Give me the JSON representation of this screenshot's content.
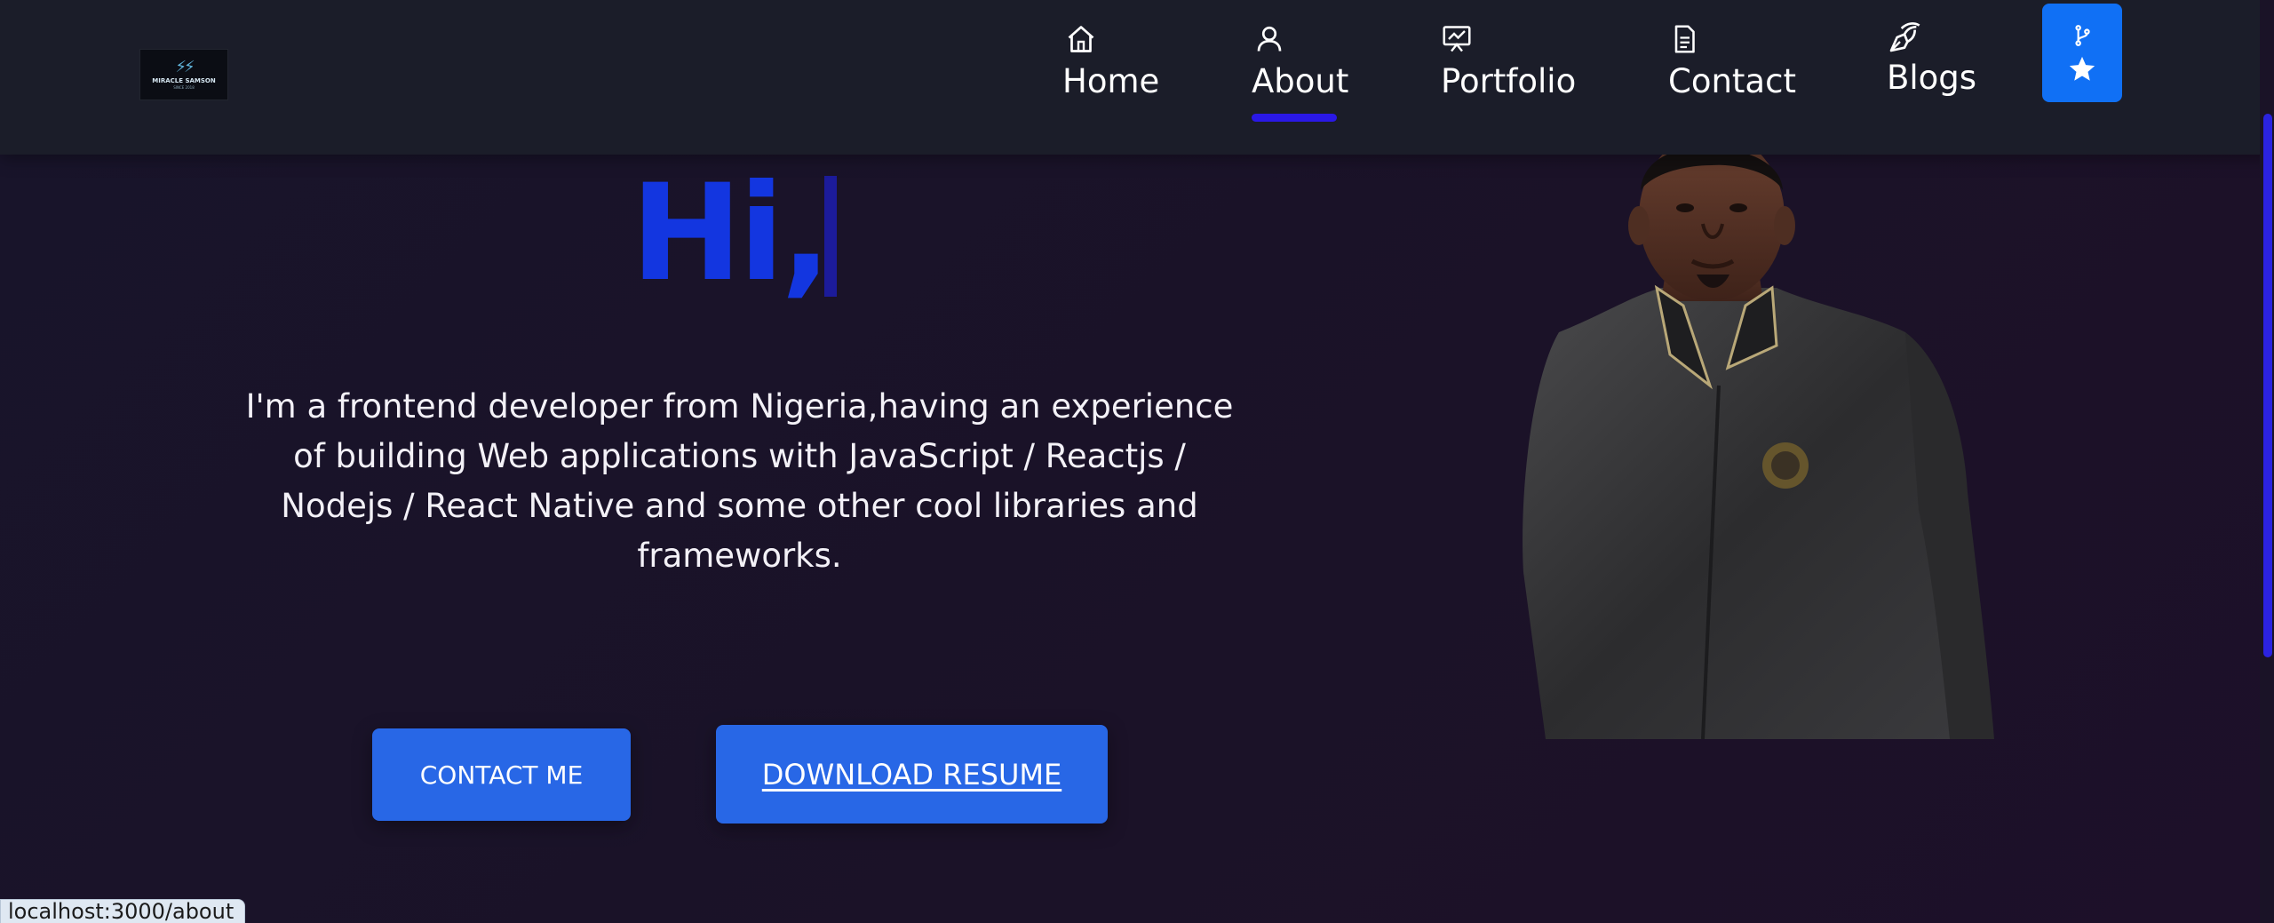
{
  "brand": {
    "logo_name": "MIRACLE SAMSON",
    "logo_tagline": "SINCE 2018"
  },
  "nav": {
    "items": [
      {
        "label": "Home",
        "icon": "home-icon",
        "active": false
      },
      {
        "label": "About",
        "icon": "user-icon",
        "active": true
      },
      {
        "label": "Portfolio",
        "icon": "presentation-chart-icon",
        "active": false
      },
      {
        "label": "Contact",
        "icon": "document-icon",
        "active": false
      },
      {
        "label": "Blogs",
        "icon": "pen-nib-icon",
        "active": false
      }
    ],
    "github_button_icons": [
      "git-fork-icon",
      "star-icon"
    ]
  },
  "hero": {
    "greeting": "Hi,",
    "intro": "I'm a frontend developer from Nigeria,having an experience of building Web applications with JavaScript / Reactjs / Nodejs / React Native and some other cool libraries and frameworks.",
    "contact_button": "CONTACT ME",
    "resume_button": "DOWNLOAD RESUME"
  },
  "status_bar": {
    "url": "localhost:3000/about"
  },
  "colors": {
    "background": "#1b1228",
    "navbar": "#1b1d29",
    "accent_blue": "#1336e0",
    "nav_underline": "#2a18e6",
    "button_blue": "#2867e6",
    "github_button": "#1070f5"
  }
}
